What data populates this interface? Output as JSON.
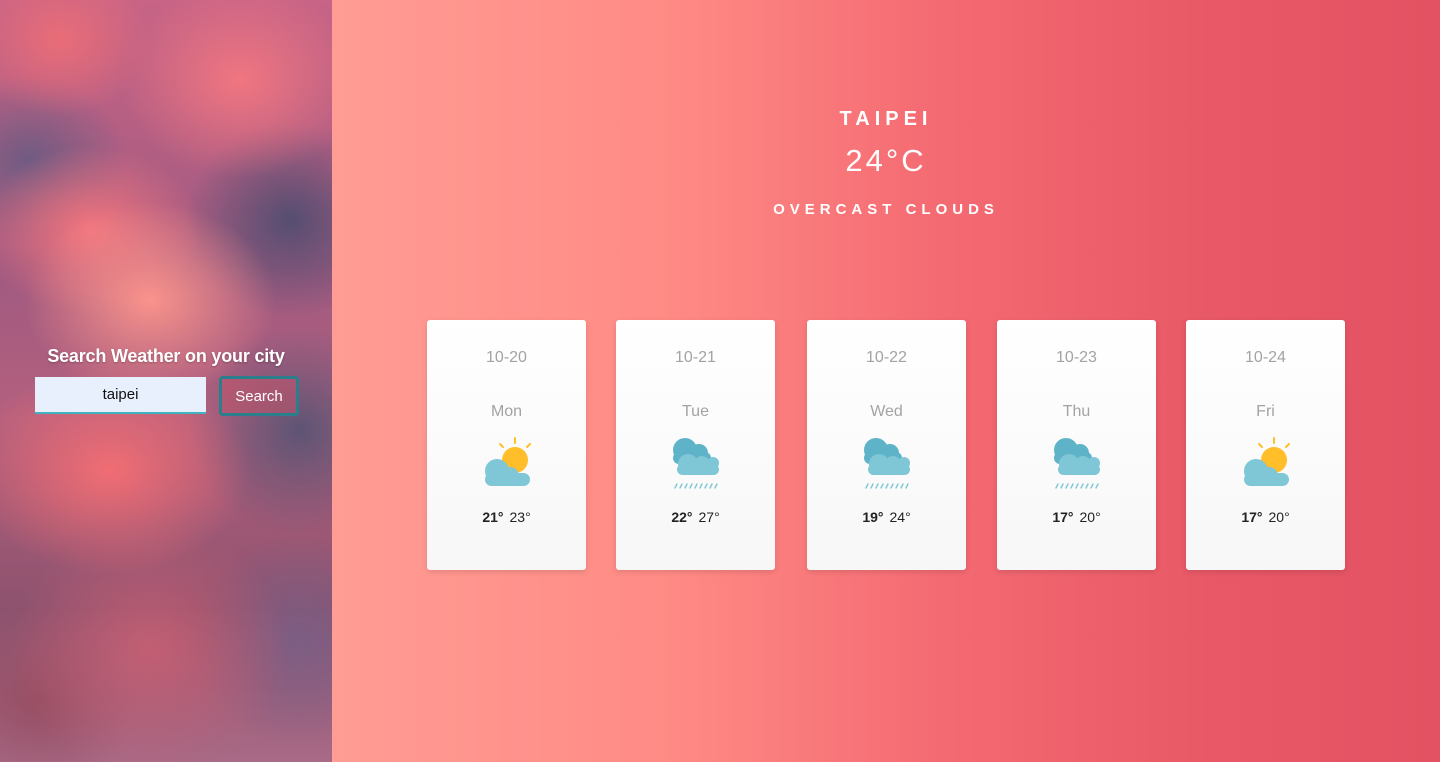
{
  "search": {
    "title": "Search Weather on your city",
    "input_value": "taipei",
    "button_label": "Search"
  },
  "current": {
    "city": "TAIPEI",
    "temperature": "24°C",
    "description": "OVERCAST CLOUDS"
  },
  "forecast": [
    {
      "date": "10-20",
      "day": "Mon",
      "icon": "partly-sunny-icon",
      "min": "21°",
      "max": "23°"
    },
    {
      "date": "10-21",
      "day": "Tue",
      "icon": "rain-cloud-icon",
      "min": "22°",
      "max": "27°"
    },
    {
      "date": "10-22",
      "day": "Wed",
      "icon": "rain-cloud-icon",
      "min": "19°",
      "max": "24°"
    },
    {
      "date": "10-23",
      "day": "Thu",
      "icon": "rain-cloud-icon",
      "min": "17°",
      "max": "20°"
    },
    {
      "date": "10-24",
      "day": "Fri",
      "icon": "partly-sunny-icon",
      "min": "17°",
      "max": "20°"
    }
  ],
  "colors": {
    "cloud": "#7fc6d6",
    "cloud_dark": "#5fb3c8",
    "sun": "#ffbe2a",
    "input_bg": "#e8f0fe",
    "button_border": "#2b7f8c"
  }
}
